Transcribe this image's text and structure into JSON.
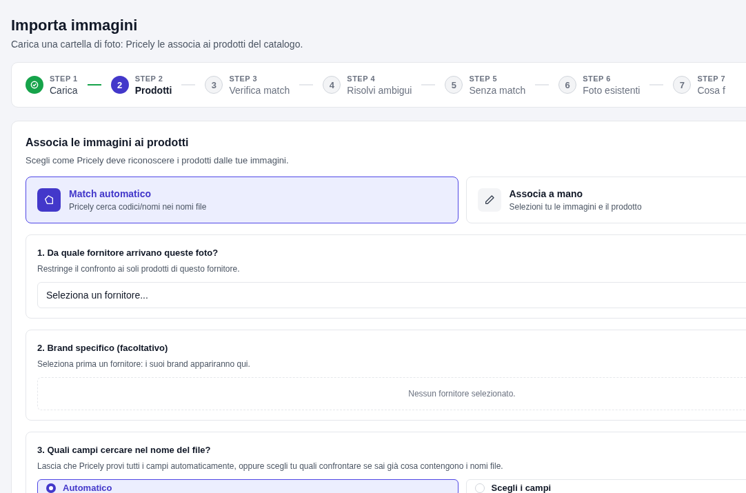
{
  "header": {
    "title": "Importa immagini",
    "subtitle": "Carica una cartella di foto: Pricely le associa ai prodotti del catalogo."
  },
  "steps": [
    {
      "caption": "STEP 1",
      "label": "Carica",
      "kind": "done"
    },
    {
      "number": "2",
      "caption": "STEP 2",
      "label": "Prodotti",
      "kind": "active"
    },
    {
      "number": "3",
      "caption": "STEP 3",
      "label": "Verifica match",
      "kind": "pending"
    },
    {
      "number": "4",
      "caption": "STEP 4",
      "label": "Risolvi ambigui",
      "kind": "pending"
    },
    {
      "number": "5",
      "caption": "STEP 5",
      "label": "Senza match",
      "kind": "pending"
    },
    {
      "number": "6",
      "caption": "STEP 6",
      "label": "Foto esistenti",
      "kind": "pending"
    },
    {
      "number": "7",
      "caption": "STEP 7",
      "label": "Cosa f",
      "kind": "pending"
    }
  ],
  "panel": {
    "title": "Associa le immagini ai prodotti",
    "subtitle": "Scegli come Pricely deve riconoscere i prodotti dalle tue immagini.",
    "modes": [
      {
        "title": "Match automatico",
        "description": "Pricely cerca codici/nomi nei nomi file",
        "selected": true
      },
      {
        "title": "Associa a mano",
        "description": "Selezioni tu le immagini e il prodotto",
        "selected": false
      }
    ],
    "sections": [
      {
        "kind": "select",
        "title": "1. Da quale fornitore arrivano queste foto?",
        "hint": "Restringe il confronto ai soli prodotti di questo fornitore.",
        "placeholder": "Seleziona un fornitore..."
      },
      {
        "kind": "empty",
        "title": "2. Brand specifico (facoltativo)",
        "hint": "Seleziona prima un fornitore: i suoi brand appariranno qui.",
        "message": "Nessun fornitore selezionato."
      },
      {
        "kind": "radio",
        "title": "3. Quali campi cercare nel nome del file?",
        "hint": "Lascia che Pricely provi tutti i campi automaticamente, oppure scegli tu quali confrontare se sai già cosa contengono i nomi file.",
        "options": [
          {
            "label": "Automatico",
            "selected": true
          },
          {
            "label": "Scegli i campi",
            "selected": false
          }
        ]
      }
    ]
  }
}
